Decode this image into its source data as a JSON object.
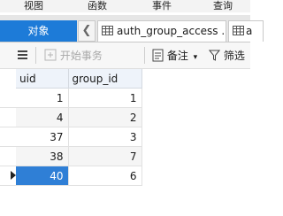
{
  "menu": [
    "视图",
    "函数",
    "事件",
    "查询"
  ],
  "tabs": {
    "active": "对象",
    "file_tab_1": "auth_group_access ...",
    "file_tab_2": "a"
  },
  "toolbar": {
    "begin_transaction": "开始事务",
    "memo": "备注",
    "filter": "筛选"
  },
  "grid": {
    "columns": [
      "uid",
      "group_id"
    ],
    "rows": [
      {
        "uid": "1",
        "group_id": "1"
      },
      {
        "uid": "4",
        "group_id": "2"
      },
      {
        "uid": "37",
        "group_id": "3"
      },
      {
        "uid": "38",
        "group_id": "7"
      },
      {
        "uid": "40",
        "group_id": "6"
      }
    ],
    "current_row_index": 4
  },
  "colors": {
    "active_tab": "#1d7bd8",
    "selected_cell": "#2f7fd6",
    "header_bg": "#eef3fa"
  }
}
